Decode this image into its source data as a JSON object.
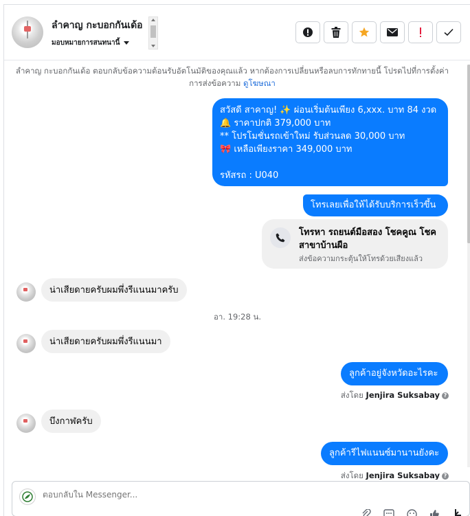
{
  "header": {
    "contact_name": "ลำคาญ กะบอกกันเด้อ",
    "assign_label": "มอบหมายการสนทนานี้",
    "actions": [
      {
        "name": "report-spam-button",
        "icon": "alert-circle-icon"
      },
      {
        "name": "delete-button",
        "icon": "trash-icon"
      },
      {
        "name": "star-button",
        "icon": "star-icon"
      },
      {
        "name": "mark-unread-button",
        "icon": "envelope-icon"
      },
      {
        "name": "follow-up-button",
        "icon": "exclamation-icon"
      },
      {
        "name": "mark-done-button",
        "icon": "check-icon"
      }
    ]
  },
  "notice": {
    "text": "ลำคาญ กะบอกกันเด้อ ตอบกลับข้อความต้อนรับอัตโนมัติของคุณแล้ว หากต้องการเปลี่ยนหรือลบการทักทายนี้ โปรดไปที่การตั้งค่าการส่งข้อความ",
    "link": "ดูโฆษณา"
  },
  "messages": {
    "promo": {
      "line1": "สวัสดี สาคาญ! ✨  ผ่อนเริ่มต้นเพียง 6,xxx. บาท 84 งวด",
      "line2": "🔔 ราคาปกติ 379,000 บาท",
      "line3": "** โปรโมชั่นรถเข้าใหม่ รับส่วนลด 30,000 บาท",
      "line4": "🎀  เหลือเพียงราคา 349,000 บาท",
      "line5": "รหัสรถ : U040"
    },
    "call_prompt": "โทรเลยเพื่อให้ได้รับบริการเร็วขึ้น",
    "call_card": {
      "title": "โทรหา รถยนต์มือสอง โชคคูณ โชค สาขาบ้านผือ",
      "subtitle": "ส่งข้อความกระตุ้นให้โทรด้วยเสียงแล้ว"
    },
    "in_1": "น่าเสียดายครับผมพึ่งรีแนนมาครับ",
    "timestamp": "อา. 19:28 น.",
    "in_2": "น่าเสียดายครับผมพึ่งรีแนนมา",
    "out_1": "ลูกค้าอยู่จังหวัดอะไรคะ",
    "sent_by_1": {
      "prefix": "ส่งโดย",
      "name": "Jenjira Suksabay"
    },
    "in_3": "บึงกาฬครับ",
    "out_2": "ลูกค้ารีไฟแนนซ์มานานยังคะ",
    "sent_by_2": {
      "prefix": "ส่งโดย",
      "name": "Jenjira Suksabay"
    }
  },
  "composer": {
    "placeholder": "ตอบกลับใน Messenger..."
  },
  "colors": {
    "outgoing_bubble": "#0a7cff",
    "incoming_bubble": "#f0f0f0",
    "star": "#f5a623",
    "follow_up": "#e41e3f"
  }
}
